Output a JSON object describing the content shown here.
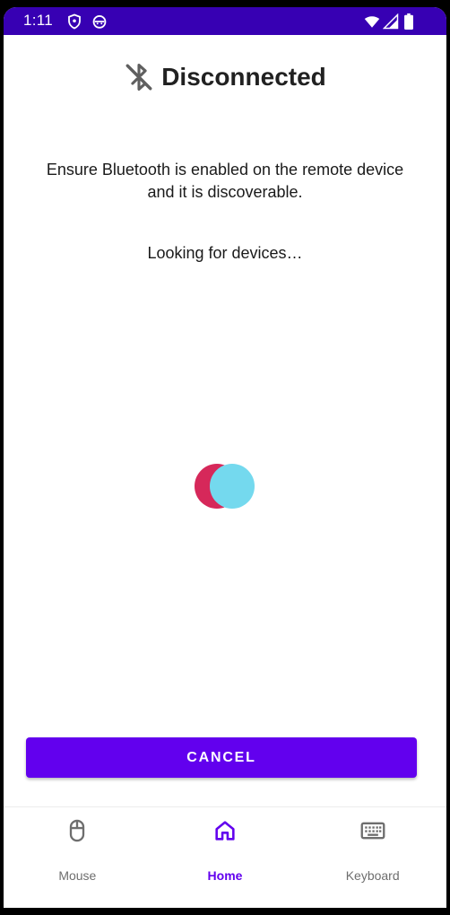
{
  "status_bar": {
    "time": "1:11",
    "background": "#3700b3",
    "icons_left": [
      "shield-icon",
      "android-face-icon"
    ],
    "icons_right": [
      "wifi-icon",
      "cell-signal-icon",
      "battery-icon"
    ]
  },
  "header": {
    "icon": "bluetooth-disabled-icon",
    "title": "Disconnected"
  },
  "main": {
    "instructions": "Ensure Bluetooth is enabled on the remote device and it is discoverable.",
    "status": "Looking for devices…",
    "spinner_colors": [
      "#d6285a",
      "#74d9ee"
    ]
  },
  "actions": {
    "cancel_label": "CANCEL",
    "accent": "#6200ee"
  },
  "bottom_nav": {
    "items": [
      {
        "label": "Mouse",
        "icon": "mouse-icon",
        "active": false
      },
      {
        "label": "Home",
        "icon": "home-icon",
        "active": true
      },
      {
        "label": "Keyboard",
        "icon": "keyboard-icon",
        "active": false
      }
    ]
  }
}
